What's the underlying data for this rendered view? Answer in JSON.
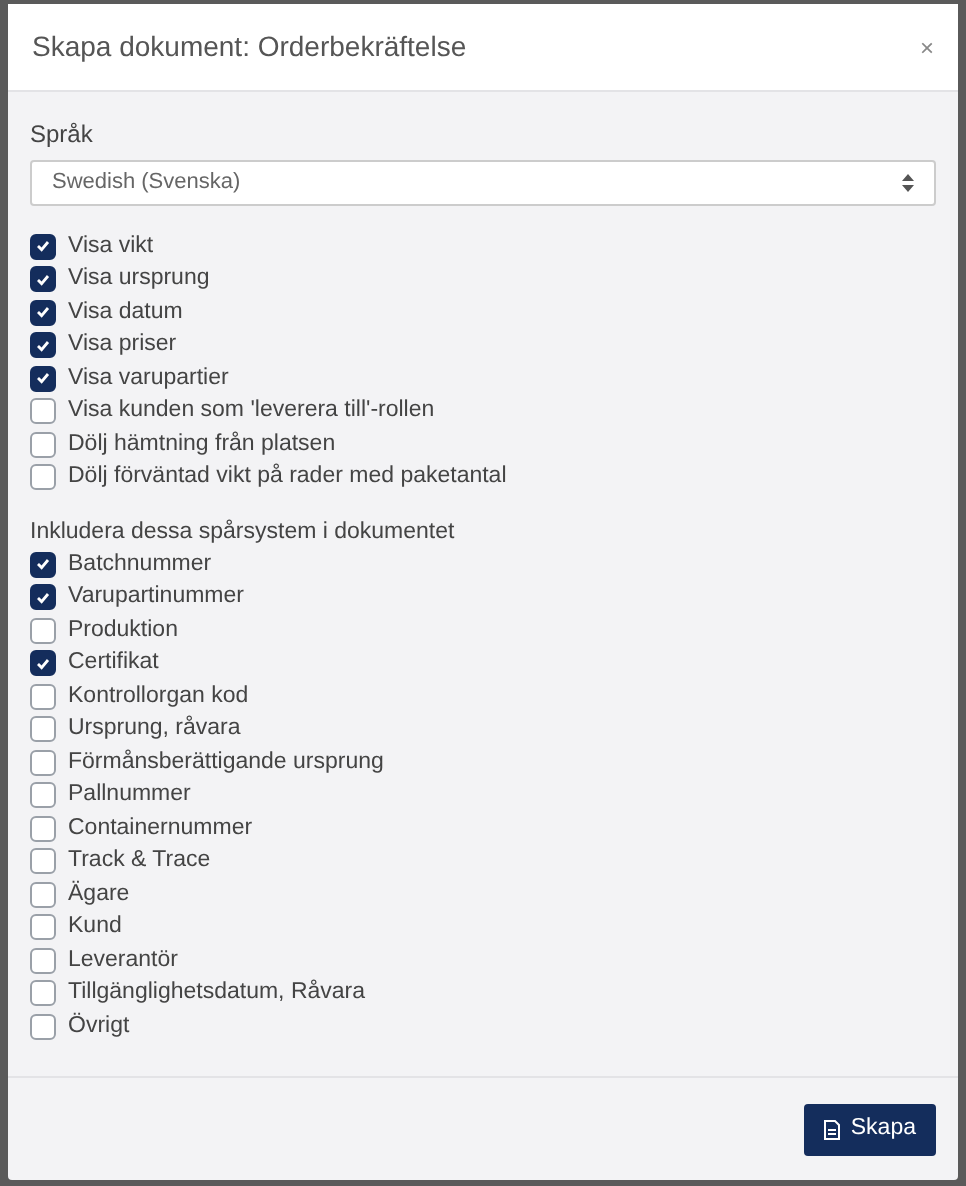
{
  "dialog": {
    "title": "Skapa dokument: Orderbekräftelse",
    "close": "×"
  },
  "language": {
    "label": "Språk",
    "value": "Swedish (Svenska)"
  },
  "options": [
    {
      "label": "Visa vikt",
      "checked": true
    },
    {
      "label": "Visa ursprung",
      "checked": true
    },
    {
      "label": "Visa datum",
      "checked": true
    },
    {
      "label": "Visa priser",
      "checked": true
    },
    {
      "label": "Visa varupartier",
      "checked": true
    },
    {
      "label": "Visa kunden som 'leverera till'-rollen",
      "checked": false
    },
    {
      "label": "Dölj hämtning från platsen",
      "checked": false
    },
    {
      "label": "Dölj förväntad vikt på rader med paketantal",
      "checked": false
    }
  ],
  "tracking": {
    "heading": "Inkludera dessa spårsystem i dokumentet",
    "items": [
      {
        "label": "Batchnummer",
        "checked": true
      },
      {
        "label": "Varupartinummer",
        "checked": true
      },
      {
        "label": "Produktion",
        "checked": false
      },
      {
        "label": "Certifikat",
        "checked": true
      },
      {
        "label": "Kontrollorgan kod",
        "checked": false
      },
      {
        "label": "Ursprung, råvara",
        "checked": false
      },
      {
        "label": "Förmånsberättigande ursprung",
        "checked": false
      },
      {
        "label": "Pallnummer",
        "checked": false
      },
      {
        "label": "Containernummer",
        "checked": false
      },
      {
        "label": "Track & Trace",
        "checked": false
      },
      {
        "label": "Ägare",
        "checked": false
      },
      {
        "label": "Kund",
        "checked": false
      },
      {
        "label": "Leverantör",
        "checked": false
      },
      {
        "label": "Tillgänglighetsdatum, Råvara",
        "checked": false
      },
      {
        "label": "Övrigt",
        "checked": false
      }
    ]
  },
  "footer": {
    "button": "Skapa"
  }
}
